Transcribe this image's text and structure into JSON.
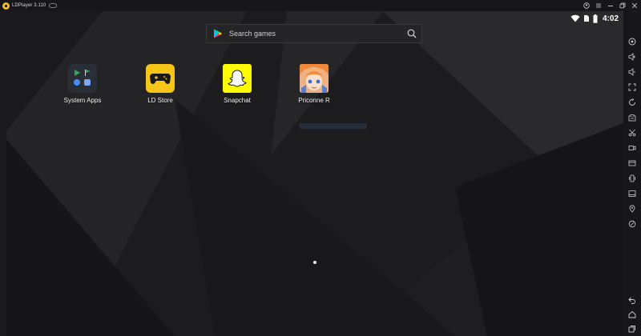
{
  "window": {
    "title": "LDPlayer 3.110",
    "controls": [
      "account-icon",
      "settings-menu-icon",
      "minimize-icon",
      "restore-icon",
      "close-icon"
    ]
  },
  "status_bar": {
    "time": "4:02",
    "icons": [
      "wifi-icon",
      "sim-icon",
      "battery-icon"
    ]
  },
  "search": {
    "placeholder": "Search games"
  },
  "apps": [
    {
      "label": "System Apps",
      "icon": "system-apps-icon"
    },
    {
      "label": "LD Store",
      "icon": "ld-store-icon"
    },
    {
      "label": "Snapchat",
      "icon": "snapchat-icon"
    },
    {
      "label": "Priconne R",
      "icon": "priconne-r-icon"
    }
  ],
  "page_indicator": {
    "pages": 1,
    "current": 1
  },
  "toolbar": {
    "tools": [
      "keyboard-mapping-icon",
      "volume-up-icon",
      "volume-down-icon",
      "fullscreen-icon",
      "sync-icon",
      "apk-install-icon",
      "scissors-icon",
      "record-icon",
      "screenshot-icon",
      "shake-icon",
      "multi-window-icon",
      "location-icon",
      "rotate-icon"
    ],
    "nav": [
      "back-icon",
      "home-icon",
      "recent-apps-icon"
    ]
  },
  "colors": {
    "ld_store_yellow": "#f5c518",
    "snapchat_yellow": "#fffc00",
    "accent_orange": "#f5b922"
  }
}
